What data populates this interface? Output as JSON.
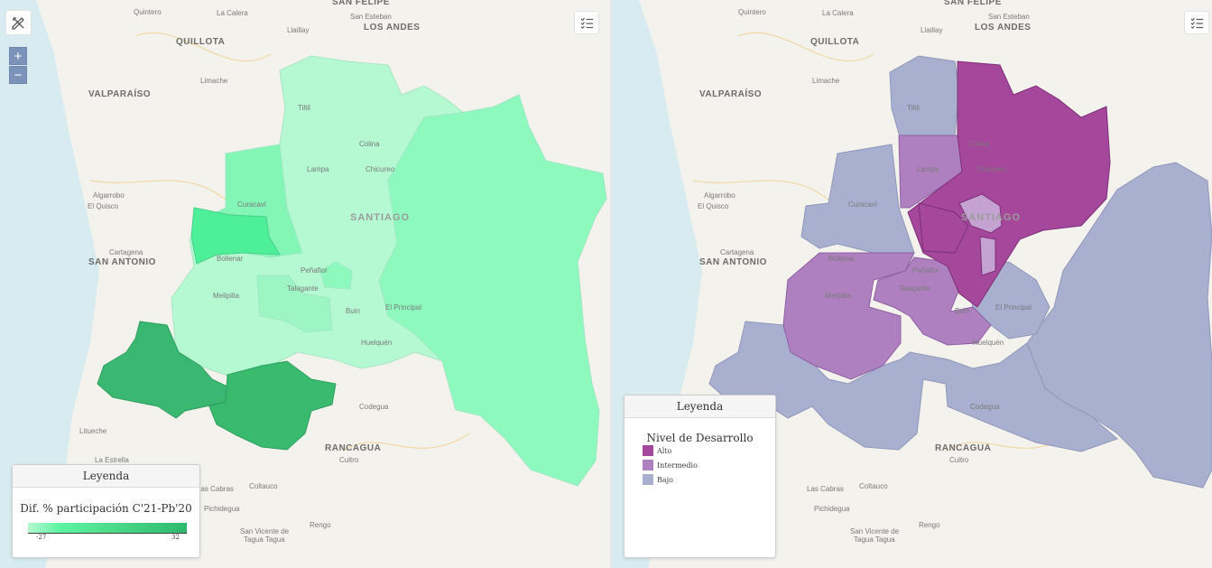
{
  "left_map": {
    "legend_header": "Leyenda",
    "legend_title": "Dif. % participación C'21-Pb'20",
    "scale_min": "-27",
    "scale_max": "32",
    "scale_color_low": "#b4f9d2",
    "scale_color_mid": "#5ef39f",
    "scale_color_high": "#2eb86b"
  },
  "right_map": {
    "legend_header": "Leyenda",
    "legend_title": "Nivel de Desarrollo",
    "categories": [
      {
        "label": "Alto",
        "color": "#a5479a"
      },
      {
        "label": "Intermedio",
        "color": "#ae80c0"
      },
      {
        "label": "Bajo",
        "color": "#a9b0cf"
      }
    ]
  },
  "controls": {
    "zoom_in": "+",
    "zoom_out": "−",
    "draw_tool_icon": "pencil-ruler-icon",
    "layers_icon": "checklist-icon"
  },
  "places": {
    "quintero": "Quintero",
    "la_calera": "La Calera",
    "san_felipe": "SAN FELIPE",
    "san_esteban": "San Esteban",
    "quillota": "QUILLOTA",
    "llaillay": "Llaillay",
    "los_andes": "LOS ANDES",
    "valparaiso": "VALPARAÍSO",
    "limache": "Limache",
    "tiltil": "Tiltil",
    "colina": "Colina",
    "lampa": "Lampa",
    "chicureo": "Chicureo",
    "algarrobo": "Algarrobo",
    "el_quisco": "El Quisco",
    "curacavi": "Curacaví",
    "santiago": "SANTIAGO",
    "cartagena": "Cartagena",
    "san_antonio": "SAN ANTONIO",
    "bollenar": "Bollenar",
    "penaflor": "Peñaflor",
    "melipilla": "Melipilla",
    "talagante": "Talagante",
    "buin": "Buin",
    "el_principal": "El Principal",
    "huelquen": "Huelquén",
    "litueche": "Litueche",
    "codegua": "Codegua",
    "la_estrella": "La Estrella",
    "rancagua": "RANCAGUA",
    "cultro": "Cultro",
    "las_cabras": "Las Cabras",
    "coltauco": "Coltauco",
    "pichidegua": "Pichidegua",
    "rengo": "Rengo",
    "san_vicente": "San Vicente de",
    "tagua_tagua": "Tagua Tagua"
  }
}
